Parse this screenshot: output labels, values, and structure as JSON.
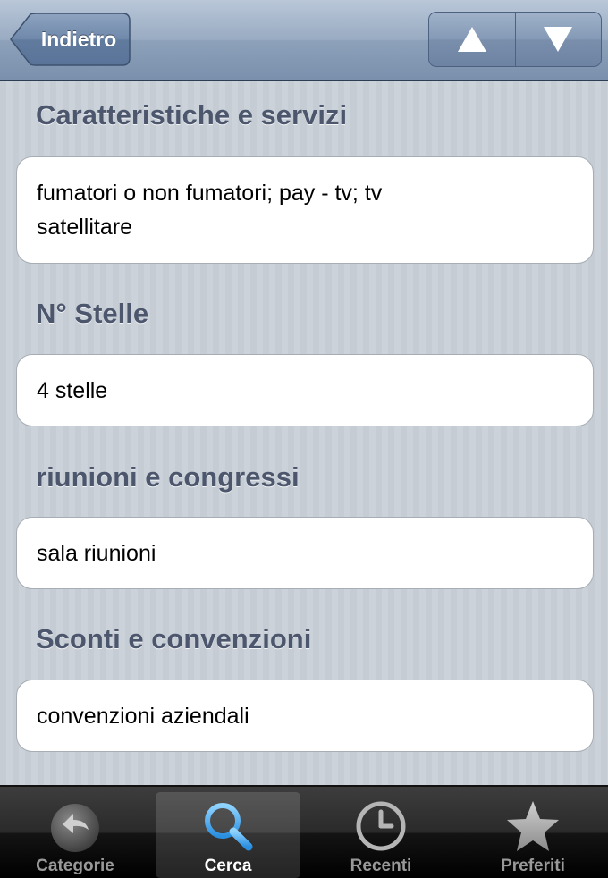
{
  "navbar": {
    "back_label": "Indietro",
    "prev_icon": "triangle-up-icon",
    "next_icon": "triangle-down-icon"
  },
  "sections": [
    {
      "title": "Caratteristiche e servizi",
      "value_lines": [
        "fumatori o non fumatori; pay - tv; tv",
        "satellitare"
      ]
    },
    {
      "title": "N° Stelle",
      "value_lines": [
        "4 stelle"
      ]
    },
    {
      "title": "riunioni e congressi",
      "value_lines": [
        "sala riunioni"
      ]
    },
    {
      "title": "Sconti e convenzioni",
      "value_lines": [
        "convenzioni aziendali"
      ]
    }
  ],
  "tabbar": {
    "tabs": [
      {
        "label": "Categorie",
        "icon": "back-arrow-icon",
        "active": false
      },
      {
        "label": "Cerca",
        "icon": "magnifier-icon",
        "active": true
      },
      {
        "label": "Recenti",
        "icon": "clock-icon",
        "active": false
      },
      {
        "label": "Preferiti",
        "icon": "star-icon",
        "active": false
      }
    ]
  },
  "colors": {
    "navbar": "#8da1ba",
    "section_title": "#4c566c",
    "background": "#c5ccd4",
    "tab_active": "#ffffff",
    "tab_inactive": "#999999"
  }
}
